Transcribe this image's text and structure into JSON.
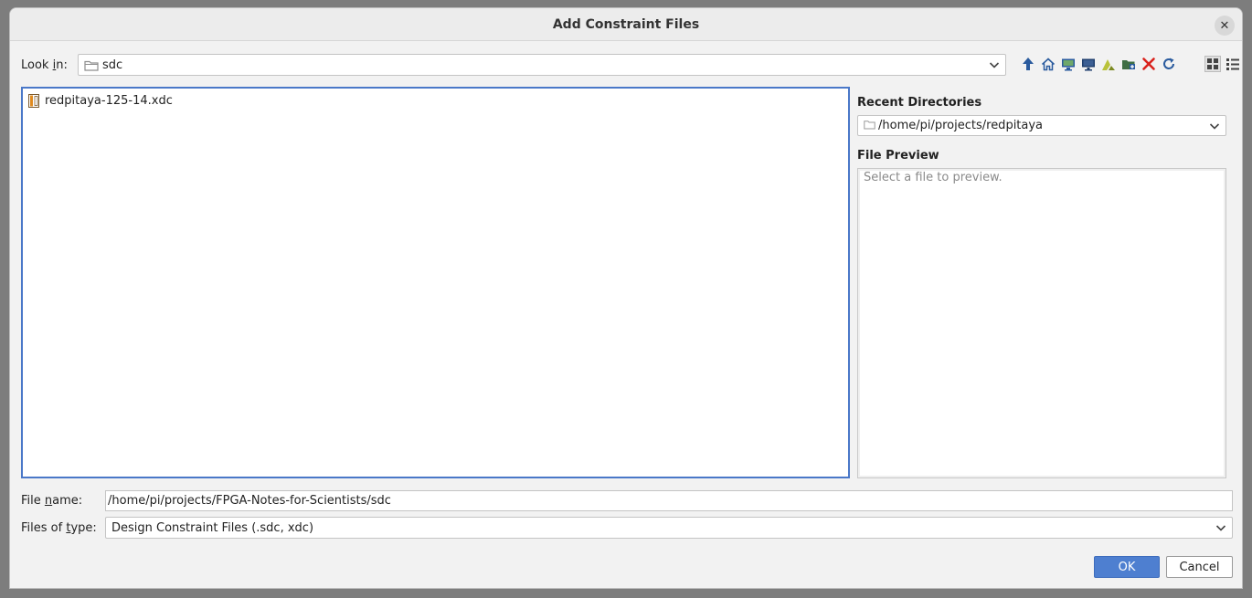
{
  "dialog": {
    "title": "Add Constraint Files",
    "close_glyph": "✕"
  },
  "look_in": {
    "label_pre": "Look ",
    "label_mnemonic": "i",
    "label_post": "n:",
    "value": "sdc"
  },
  "toolbar": {
    "icons": [
      "up-folder-icon",
      "home-icon",
      "desktop-icon",
      "computer-icon",
      "vivado-icon",
      "new-folder-icon",
      "delete-icon",
      "refresh-icon",
      "grid-view-icon",
      "list-view-icon"
    ]
  },
  "file_list": {
    "items": [
      {
        "name": "redpitaya-125-14.xdc",
        "icon": "xdc-file-icon"
      }
    ]
  },
  "recent": {
    "label": "Recent Directories",
    "value": "/home/pi/projects/redpitaya"
  },
  "preview": {
    "label": "File Preview",
    "placeholder": "Select a file to preview."
  },
  "file_name": {
    "label_pre": "File ",
    "label_mnemonic": "n",
    "label_post": "ame:",
    "value": "/home/pi/projects/FPGA-Notes-for-Scientists/sdc"
  },
  "file_type": {
    "label_pre": "Files of ",
    "label_mnemonic": "t",
    "label_post": "ype:",
    "value": "Design Constraint Files (.sdc, xdc)"
  },
  "buttons": {
    "ok": "OK",
    "cancel": "Cancel"
  },
  "colors": {
    "accent": "#4e7fd0",
    "selection_border": "#4a78c8",
    "delete_red": "#d9221c"
  }
}
